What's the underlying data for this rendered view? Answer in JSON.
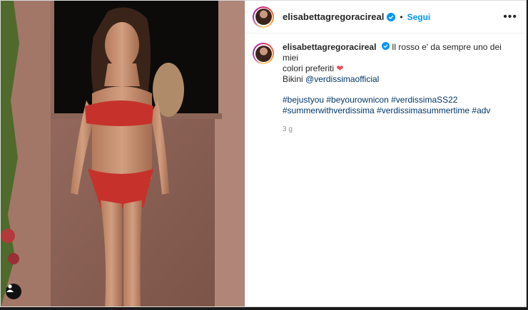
{
  "header": {
    "username": "elisabettagregoracireal",
    "separator": "•",
    "follow_label": "Segui",
    "more_label": "•••"
  },
  "caption": {
    "username": "elisabettagregoracireal",
    "text_line1": "Il rosso e' da sempre uno dei miei",
    "text_line2": "colori preferiti",
    "heart": "❤",
    "bikini_prefix": "Bikini ",
    "bikini_mention": "@verdissimaofficial",
    "hashtags_line1": "#bejustyou #beyourownicon #verdissimaSS22",
    "hashtags_line2": "#summerwithverdissima #verdissimasummertime #adv",
    "timestamp": "3 g"
  },
  "icons": {
    "verified": "verified-badge-icon",
    "tag": "user-tag-icon",
    "more": "more-options-icon"
  },
  "colors": {
    "follow": "#0095f6",
    "link": "#00376b",
    "heart": "#ed4956",
    "verified": "#0095f6"
  }
}
